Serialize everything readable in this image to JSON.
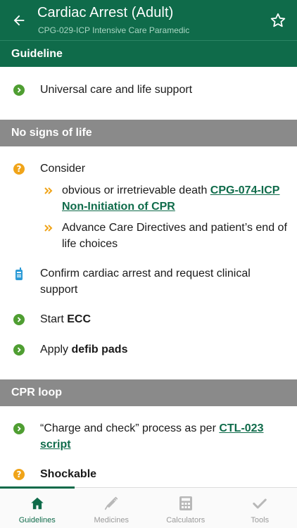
{
  "header": {
    "title": "Cardiac Arrest (Adult)",
    "subtitle": "CPG-029-ICP Intensive Care Paramedic"
  },
  "sections": {
    "guideline": {
      "title": "Guideline",
      "items": {
        "universal_care": "Universal care and life support"
      }
    },
    "no_signs": {
      "title": "No signs of life",
      "consider": "Consider",
      "sub1_text": "obvious or irretrievable death ",
      "sub1_link": "CPG-074-ICP Non-Initiation of CPR",
      "sub2_text": "Advance Care Directives and patient’s end of life choices",
      "confirm": "Confirm cardiac arrest and request clinical support",
      "start_prefix": "Start ",
      "start_bold": "ECC",
      "apply_prefix": "Apply ",
      "apply_bold": "defib pads"
    },
    "cpr_loop": {
      "title": "CPR loop",
      "charge_text": "“Charge and check” process as per ",
      "charge_link": "CTL-023 script",
      "shockable": "Shockable"
    }
  },
  "tabs": [
    {
      "label": "Guidelines",
      "icon": "home-icon",
      "active": true
    },
    {
      "label": "Medicines",
      "icon": "syringe-icon",
      "active": false
    },
    {
      "label": "Calculators",
      "icon": "calculator-icon",
      "active": false
    },
    {
      "label": "Tools",
      "icon": "check-icon",
      "active": false
    }
  ],
  "colors": {
    "brand_green": "#0f6b4a",
    "bullet_green": "#4f9e32",
    "bullet_orange": "#f0a419",
    "radio_blue": "#2b9ad6",
    "section_grey": "#8a8a8a"
  }
}
